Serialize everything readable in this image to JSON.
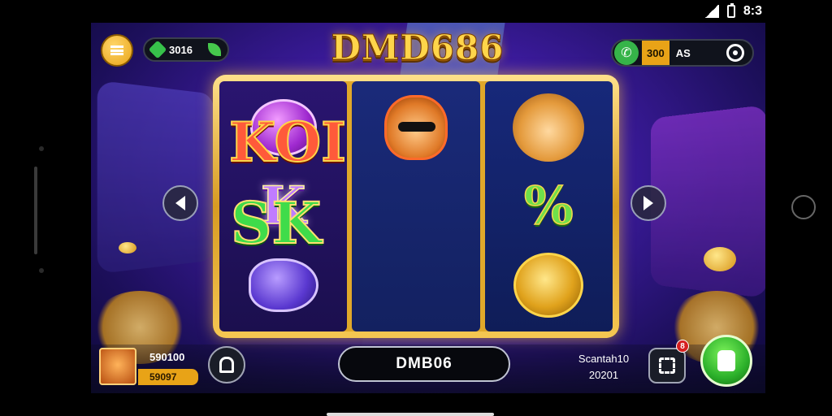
{
  "status_bar": {
    "time": "8:3",
    "signal_icon": "signal-icon",
    "battery_icon": "battery-icon"
  },
  "hud": {
    "menu_icon": "menu-icon",
    "balance": {
      "value": "3016",
      "gem_icon": "gem-icon",
      "leaf_icon": "leaf-icon"
    },
    "logo": "DMD686",
    "top_right": {
      "phone_icon": "phone-icon",
      "value1": "300",
      "value2": "AS",
      "target_icon": "target-icon"
    }
  },
  "reels": [
    [
      "swirl-orb-symbol",
      "K",
      "purple-orb-symbol"
    ],
    [
      "fox-cat-symbol",
      "KOI",
      "SK"
    ],
    [
      "lion-symbol",
      "%",
      "gold-coins-symbol"
    ]
  ],
  "big_text": {
    "koi": "KOI",
    "k_suffix": "I",
    "sk": "SK"
  },
  "controls": {
    "prev_icon": "chevron-left-icon",
    "next_icon": "chevron-right-icon"
  },
  "bottom": {
    "player": {
      "value1": "590100",
      "value2": "59097"
    },
    "lock_icon": "lock-icon",
    "spin_label": "DMB06",
    "right_stats": {
      "line1": "Scantah10",
      "line2": "20201"
    },
    "square_icon": "fullscreen-icon",
    "badge": "8",
    "play_icon": "hand-icon"
  },
  "colors": {
    "gold": "#ffd54a",
    "purple_bg": "#3a1a9a",
    "green": "#2bb02a",
    "orange": "#e8a317"
  }
}
